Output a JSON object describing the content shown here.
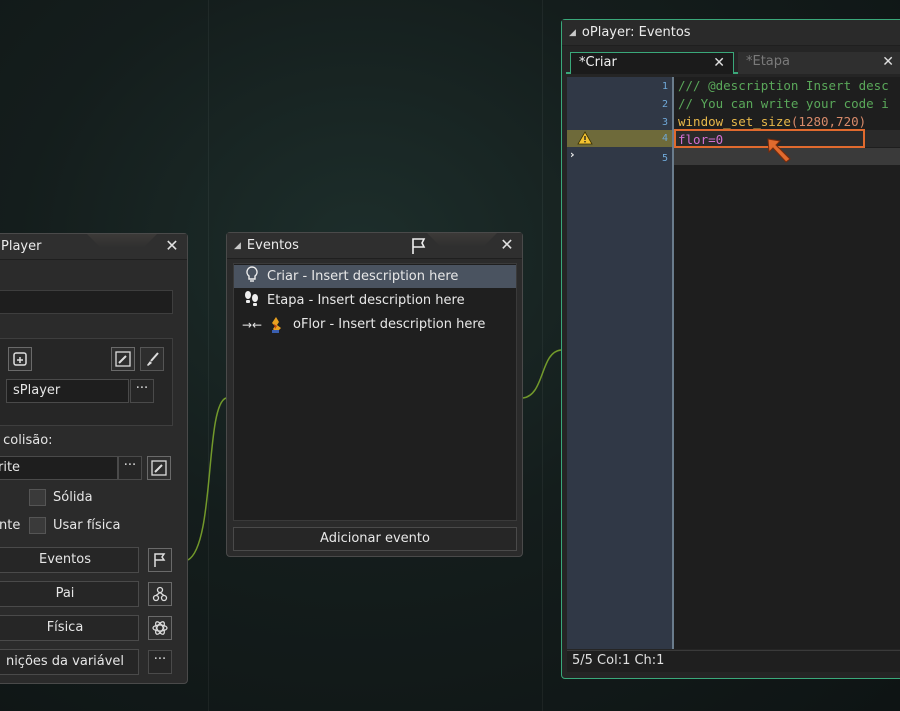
{
  "colors": {
    "accent_green": "#3aa87a",
    "highlight_orange": "#e06a2e",
    "selection": "#4a5360"
  },
  "object_panel": {
    "title": "Player",
    "sprite_name": "sPlayer",
    "collision_label": "e colisão:",
    "collision_field": "rite",
    "solid_label": "Sólida",
    "physics_check_label": "Usar física",
    "physics_prefix_label": "ente",
    "events_button": "Eventos",
    "parent_button": "Pai",
    "physics_button": "Física",
    "variables_button": "nições da variável",
    "ellipsis": "···"
  },
  "events_panel": {
    "title": "Eventos",
    "items": [
      {
        "icon": "lightbulb-icon",
        "label": "Criar - Insert description here",
        "selected": true
      },
      {
        "icon": "footsteps-icon",
        "label": "Etapa - Insert description here",
        "selected": false
      },
      {
        "icon": "collision-icon",
        "label": "oFlor - Insert description here",
        "selected": false
      }
    ],
    "add_button": "Adicionar evento"
  },
  "editor": {
    "title": "oPlayer: Eventos",
    "tabs": [
      {
        "label": "*Criar",
        "active": true
      },
      {
        "label": "*Etapa",
        "active": false
      }
    ],
    "lines": [
      {
        "n": "1",
        "text": "/// @description Insert desc",
        "color": "#5aa85a"
      },
      {
        "n": "2",
        "text": "// You can write your code i",
        "color": "#5aa85a"
      },
      {
        "n": "3",
        "text_fn": "window_set_size",
        "text_args": "(1280,720)"
      },
      {
        "n": "4",
        "text": "flor=0",
        "color": "#d26fd0"
      },
      {
        "n": "5",
        "text": ""
      }
    ],
    "status": "5/5 Col:1 Ch:1"
  }
}
